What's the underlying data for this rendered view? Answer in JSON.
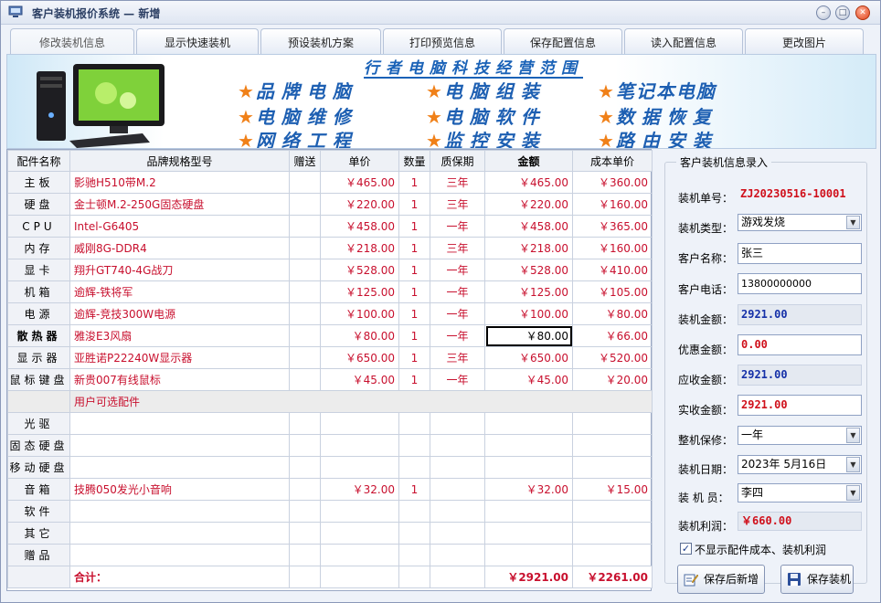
{
  "window": {
    "title": "客户装机报价系统 — 新增"
  },
  "tabs": [
    "修改装机信息",
    "显示快速装机",
    "预设装机方案",
    "打印预览信息",
    "保存配置信息",
    "读入配置信息",
    "更改图片"
  ],
  "banner": {
    "title": "行者电脑科技经营范围",
    "items": [
      "品牌电脑",
      "电脑组装",
      "笔记本电脑",
      "电脑维修",
      "电脑软件",
      "数据恢复",
      "网络工程",
      "监控安装",
      "路由安装"
    ]
  },
  "grid": {
    "headers": [
      "配件名称",
      "品牌规格型号",
      "赠送",
      "单价",
      "数量",
      "质保期",
      "金额",
      "成本单价"
    ],
    "rows": [
      {
        "name": "主板",
        "spec": "影驰H510带M.2",
        "gift": "",
        "price": "￥465.00",
        "qty": "1",
        "warranty": "三年",
        "amount": "￥465.00",
        "cost": "￥360.00"
      },
      {
        "name": "硬盘",
        "spec": "金士顿M.2-250G固态硬盘",
        "gift": "",
        "price": "￥220.00",
        "qty": "1",
        "warranty": "三年",
        "amount": "￥220.00",
        "cost": "￥160.00"
      },
      {
        "name": "CPU",
        "spec": "Intel-G6405",
        "gift": "",
        "price": "￥458.00",
        "qty": "1",
        "warranty": "一年",
        "amount": "￥458.00",
        "cost": "￥365.00"
      },
      {
        "name": "内存",
        "spec": "威刚8G-DDR4",
        "gift": "",
        "price": "￥218.00",
        "qty": "1",
        "warranty": "三年",
        "amount": "￥218.00",
        "cost": "￥160.00"
      },
      {
        "name": "显卡",
        "spec": "翔升GT740-4G战刀",
        "gift": "",
        "price": "￥528.00",
        "qty": "1",
        "warranty": "一年",
        "amount": "￥528.00",
        "cost": "￥410.00"
      },
      {
        "name": "机箱",
        "spec": "逾辉-铁将军",
        "gift": "",
        "price": "￥125.00",
        "qty": "1",
        "warranty": "一年",
        "amount": "￥125.00",
        "cost": "￥105.00"
      },
      {
        "name": "电源",
        "spec": "逾辉-竞技300W电源",
        "gift": "",
        "price": "￥100.00",
        "qty": "1",
        "warranty": "一年",
        "amount": "￥100.00",
        "cost": "￥80.00"
      },
      {
        "name": "散热器",
        "spec": "雅浚E3风扇",
        "gift": "",
        "price": "￥80.00",
        "qty": "1",
        "warranty": "一年",
        "amount": "￥80.00",
        "cost": "￥66.00"
      },
      {
        "name": "显示器",
        "spec": "亚胜诺P22240W显示器",
        "gift": "",
        "price": "￥650.00",
        "qty": "1",
        "warranty": "三年",
        "amount": "￥650.00",
        "cost": "￥520.00"
      },
      {
        "name": "鼠标键盘",
        "spec": "新贵007有线鼠标",
        "gift": "",
        "price": "￥45.00",
        "qty": "1",
        "warranty": "一年",
        "amount": "￥45.00",
        "cost": "￥20.00"
      }
    ],
    "section_label": "用户可选配件",
    "optional_rows": [
      {
        "name": "光驱",
        "spec": "",
        "gift": "",
        "price": "",
        "qty": "",
        "warranty": "",
        "amount": "",
        "cost": ""
      },
      {
        "name": "固态硬盘",
        "spec": "",
        "gift": "",
        "price": "",
        "qty": "",
        "warranty": "",
        "amount": "",
        "cost": ""
      },
      {
        "name": "移动硬盘",
        "spec": "",
        "gift": "",
        "price": "",
        "qty": "",
        "warranty": "",
        "amount": "",
        "cost": ""
      },
      {
        "name": "音箱",
        "spec": "技腾050发光小音响",
        "gift": "",
        "price": "￥32.00",
        "qty": "1",
        "warranty": "",
        "amount": "￥32.00",
        "cost": "￥15.00"
      },
      {
        "name": "软件",
        "spec": "",
        "gift": "",
        "price": "",
        "qty": "",
        "warranty": "",
        "amount": "",
        "cost": ""
      },
      {
        "name": "其它",
        "spec": "",
        "gift": "",
        "price": "",
        "qty": "",
        "warranty": "",
        "amount": "",
        "cost": ""
      },
      {
        "name": "赠品",
        "spec": "",
        "gift": "",
        "price": "",
        "qty": "",
        "warranty": "",
        "amount": "",
        "cost": ""
      }
    ],
    "total": {
      "label": "合计：",
      "amount": "￥2921.00",
      "cost": "￥2261.00"
    }
  },
  "panel": {
    "legend": "客户装机信息录入",
    "order_no_label": "装机单号：",
    "order_no": "ZJ20230516-10001",
    "type_label": "装机类型：",
    "type": "游戏发烧",
    "customer_label": "客户名称：",
    "customer": "张三",
    "phone_label": "客户电话：",
    "phone": "13800000000",
    "amount_label": "装机金额：",
    "amount": "2921.00",
    "discount_label": "优惠金额：",
    "discount": "0.00",
    "receivable_label": "应收金额：",
    "receivable": "2921.00",
    "received_label": "实收金额：",
    "received": "2921.00",
    "warranty_label": "整机保修：",
    "warranty": "一年",
    "date_label": "装机日期：",
    "date": "2023年 5月16日",
    "staff_label": "装 机 员：",
    "staff": "李四",
    "profit_label": "装机利润：",
    "profit": "￥660.00",
    "hide_cost_label": "不显示配件成本、装机利润",
    "hide_cost_checked": true,
    "save_new_label": "保存后新增",
    "save_label": "保存装机"
  }
}
